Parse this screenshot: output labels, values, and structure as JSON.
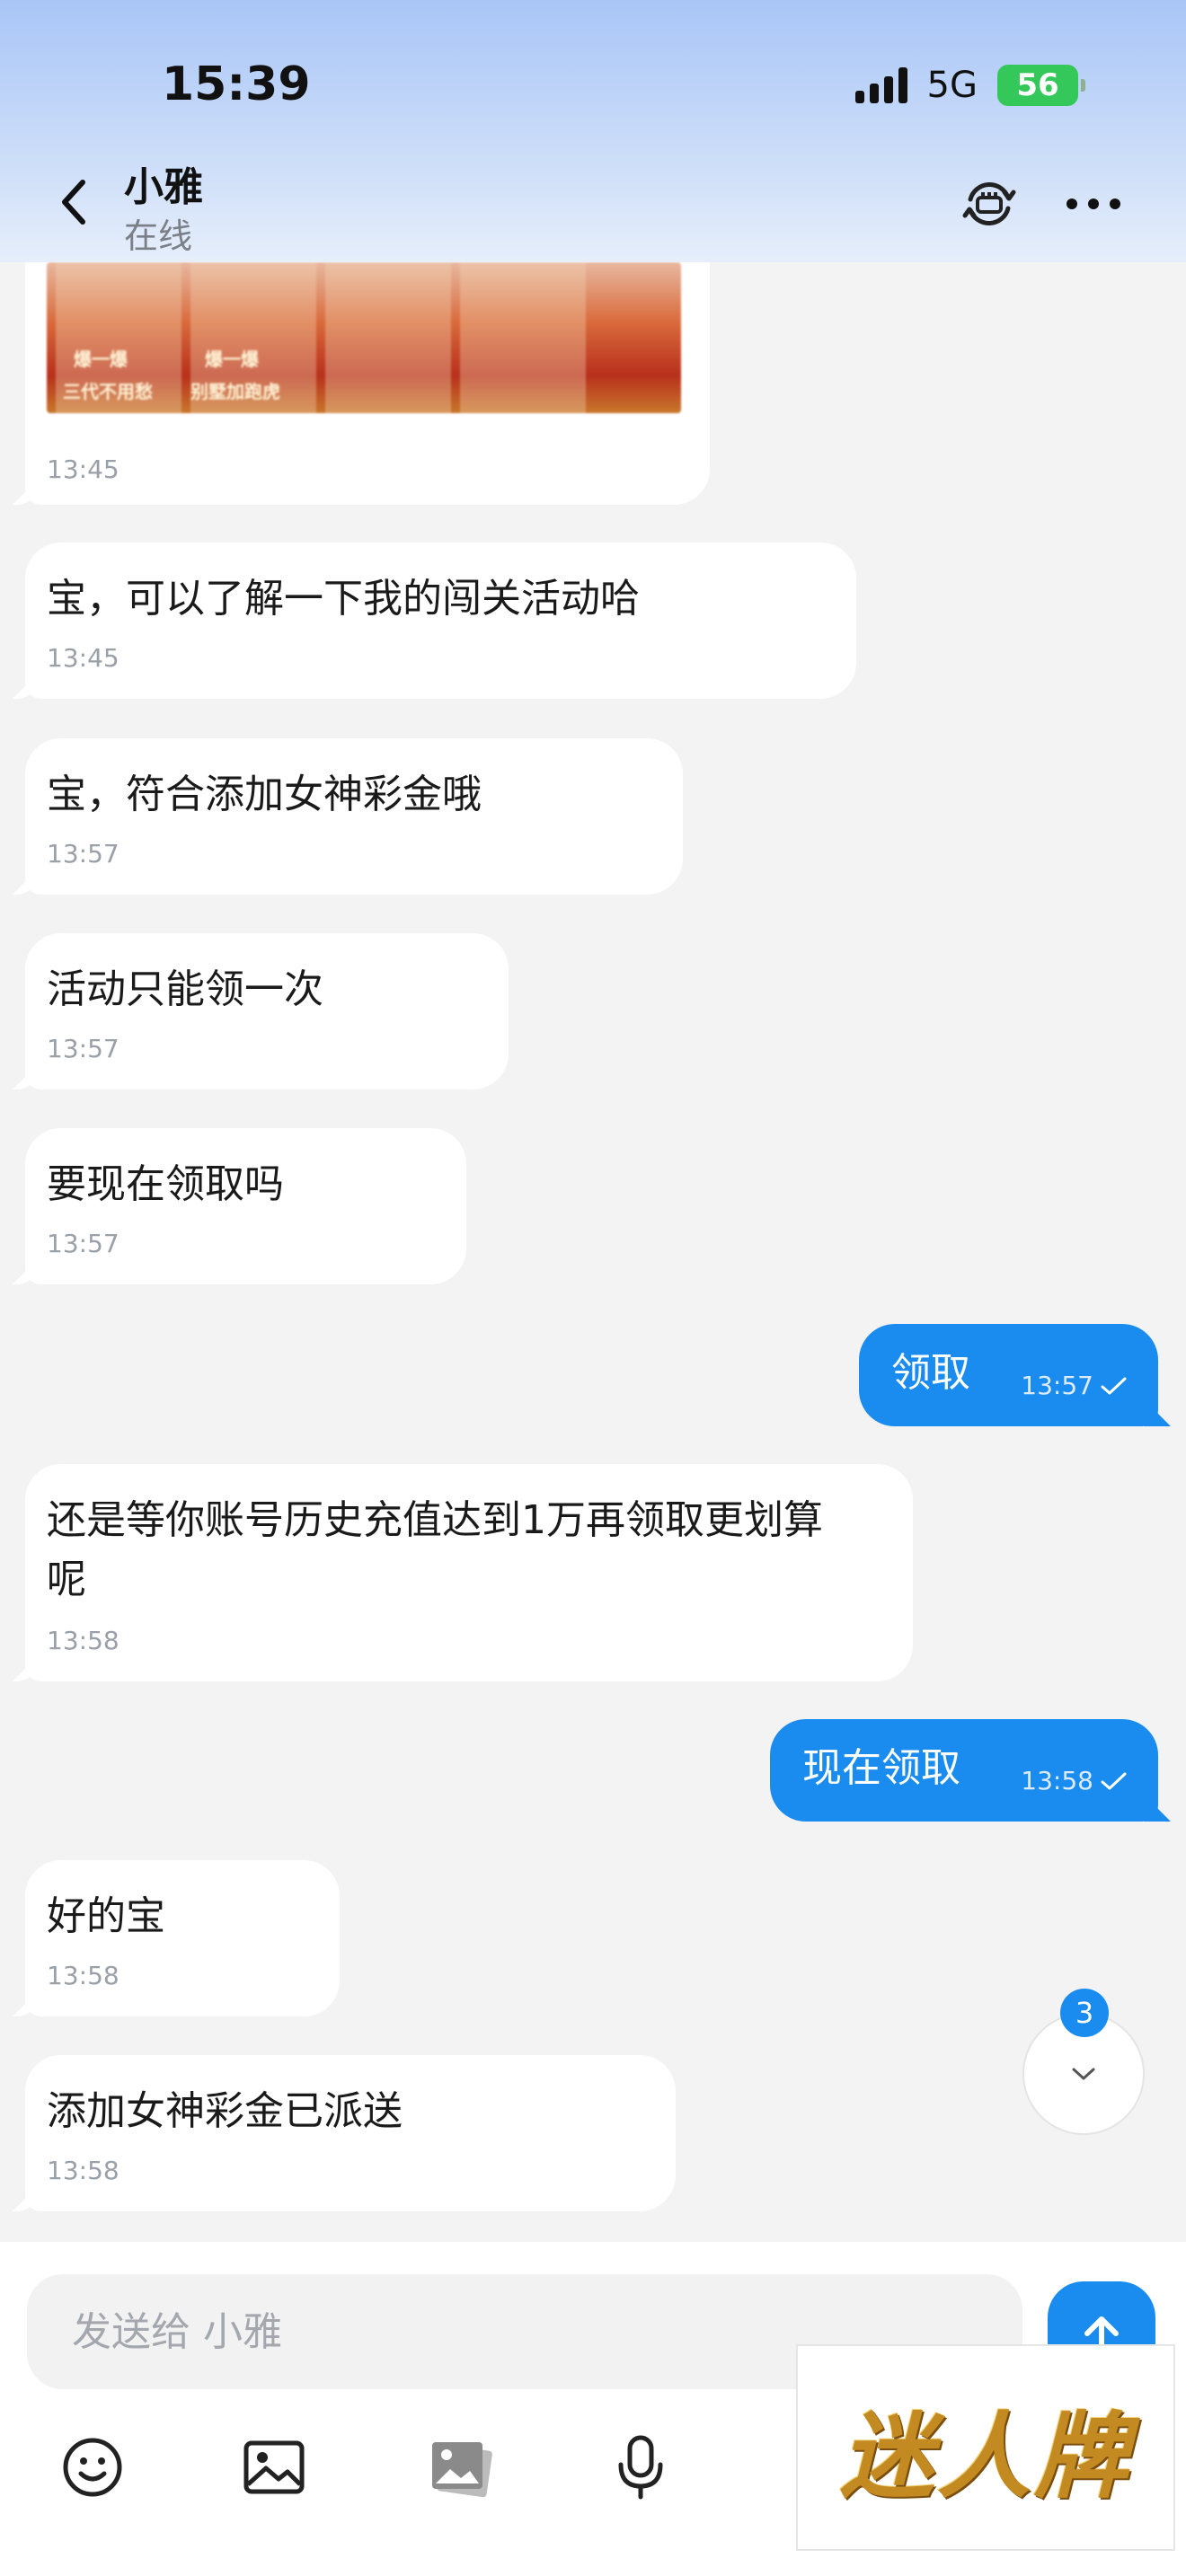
{
  "status_bar": {
    "time": "15:39",
    "network": "5G",
    "battery": "56"
  },
  "header": {
    "contact_name": "小雅",
    "contact_status": "在线"
  },
  "image_message": {
    "time": "13:45",
    "tags": [
      "爆一爆",
      "三代不用愁",
      "爆一爆",
      "别墅加跑虎"
    ]
  },
  "messages": [
    {
      "dir": "in",
      "text": "宝，可以了解一下我的闯关活动哈",
      "time": "13:45"
    },
    {
      "dir": "in",
      "text": "宝，符合添加女神彩金哦",
      "time": "13:57"
    },
    {
      "dir": "in",
      "text": "活动只能领一次",
      "time": "13:57"
    },
    {
      "dir": "in",
      "text": "要现在领取吗",
      "time": "13:57"
    },
    {
      "dir": "out",
      "text": "领取",
      "time": "13:57"
    },
    {
      "dir": "in",
      "text": "还是等你账号历史充值达到1万再领取更划算",
      "text2": "呢",
      "time": "13:58"
    },
    {
      "dir": "out",
      "text": "现在领取",
      "time": "13:58"
    },
    {
      "dir": "in",
      "text": "好的宝",
      "time": "13:58"
    },
    {
      "dir": "in",
      "text": "添加女神彩金已派送",
      "time": "13:58"
    }
  ],
  "unread_badge": "3",
  "composer": {
    "placeholder": "发送给 小雅"
  },
  "watermark": "迷人牌"
}
